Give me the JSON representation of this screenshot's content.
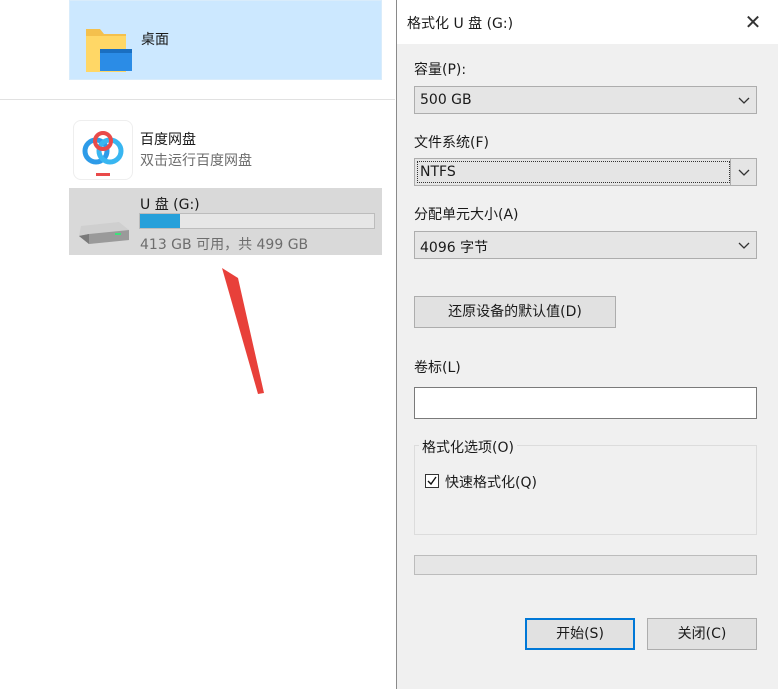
{
  "explorer": {
    "desktop": {
      "label": "桌面"
    },
    "baidu": {
      "name": "百度网盘",
      "subtitle": "双击运行百度网盘"
    },
    "drive": {
      "label": "U 盘 (G:)",
      "usage_text": "413 GB 可用，共 499 GB",
      "used_fraction": 0.17
    }
  },
  "dialog": {
    "title": "格式化 U 盘 (G:)",
    "close_glyph": "✕",
    "capacity": {
      "label": "容量(P):",
      "value": "500 GB"
    },
    "filesystem": {
      "label": "文件系统(F)",
      "value": "NTFS"
    },
    "allocation": {
      "label": "分配单元大小(A)",
      "value": "4096 字节"
    },
    "restore_defaults_label": "还原设备的默认值(D)",
    "volume_label": {
      "label": "卷标(L)",
      "value": ""
    },
    "format_options": {
      "title": "格式化选项(O)",
      "quick_format_label": "快速格式化(Q)",
      "quick_format_checked": true
    },
    "progress_fraction": 0,
    "start_label": "开始(S)",
    "close_label": "关闭(C)"
  },
  "colors": {
    "selection": "#cce8ff",
    "accent": "#0078d7",
    "progress": "#26a0da",
    "arrow": "#e8403a"
  }
}
